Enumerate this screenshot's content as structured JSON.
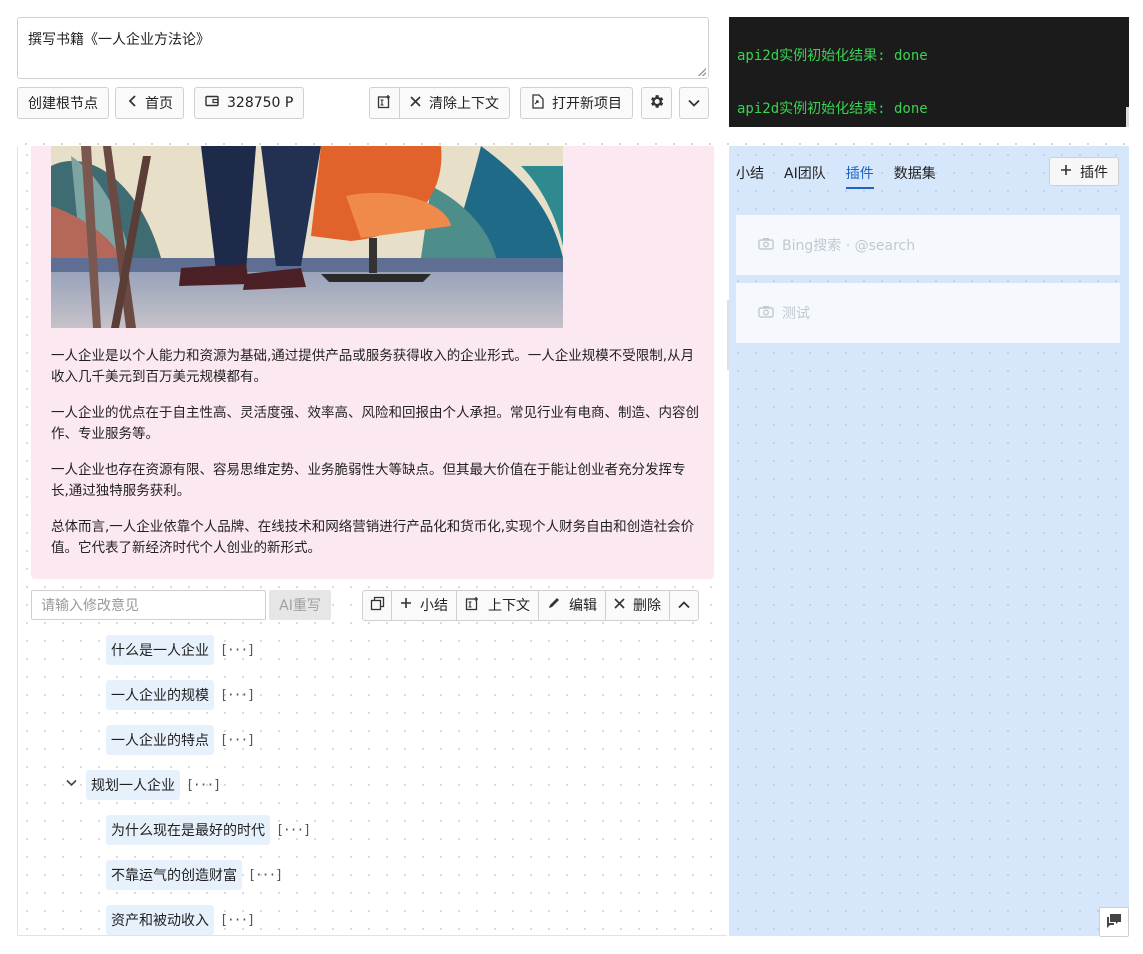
{
  "prompt": {
    "value": "撰写书籍《一人企业方法论》"
  },
  "toolbar": {
    "create_root": "创建根节点",
    "home": "首页",
    "points": "328750 P",
    "clear_context": "清除上下文",
    "open_project": "打开新项目"
  },
  "terminal": {
    "lines": [
      "api2d实例初始化结果: done",
      "api2d实例初始化结果: done"
    ]
  },
  "card": {
    "paragraphs": [
      "一人企业是以个人能力和资源为基础,通过提供产品或服务获得收入的企业形式。一人企业规模不受限制,从月收入几千美元到百万美元规模都有。",
      "一人企业的优点在于自主性高、灵活度强、效率高、风险和回报由个人承担。常见行业有电商、制造、内容创作、专业服务等。",
      "一人企业也存在资源有限、容易思维定势、业务脆弱性大等缺点。但其最大价值在于能让创业者充分发挥专长,通过独特服务获利。",
      "总体而言,一人企业依靠个人品牌、在线技术和网络营销进行产品化和货币化,实现个人财务自由和创造社会价值。它代表了新经济时代个人创业的新形式。"
    ]
  },
  "edit": {
    "placeholder": "请输入修改意见",
    "ai_rewrite": "AI重写",
    "summary": "小结",
    "context": "上下文",
    "edit": "编辑",
    "delete": "删除"
  },
  "tree": {
    "more": "[···]",
    "items": [
      {
        "label": "什么是一人企业",
        "level": 2
      },
      {
        "label": "一人企业的规模",
        "level": 2
      },
      {
        "label": "一人企业的特点",
        "level": 2
      },
      {
        "label": "规划一人企业",
        "level": 1
      },
      {
        "label": "为什么现在是最好的时代",
        "level": 2
      },
      {
        "label": "不靠运气的创造财富",
        "level": 2
      },
      {
        "label": "资产和被动收入",
        "level": 2
      }
    ]
  },
  "right": {
    "tabs": [
      "小结",
      "AI团队",
      "插件",
      "数据集"
    ],
    "active_tab": "插件",
    "add_plugin": "插件",
    "plugins": [
      "Bing搜索 · @search",
      "测试"
    ]
  },
  "colors": {
    "accent": "#1e64c8",
    "card_bg": "#fce8f1",
    "terminal_fg": "#39d353",
    "right_bg": "#d6e6fb"
  }
}
